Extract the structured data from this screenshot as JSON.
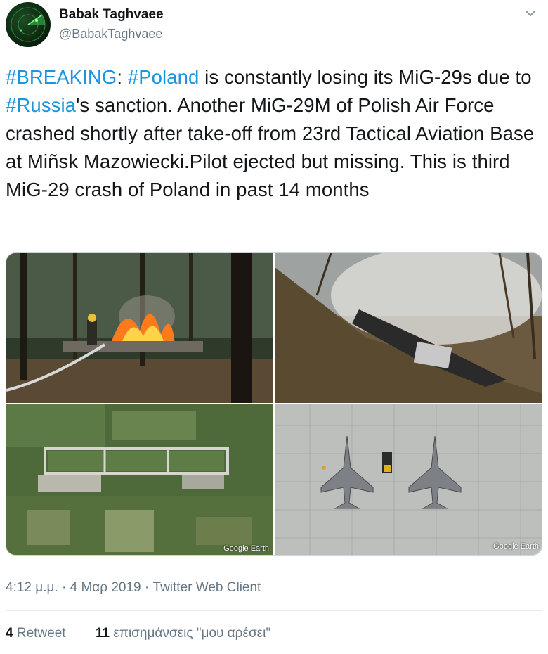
{
  "author": {
    "name": "Babak Taghvaee",
    "handle": "@BabakTaghvaee",
    "avatar_icon": "radar-avatar-icon"
  },
  "menu_icon": "chevron-down-icon",
  "tweet": {
    "segments": [
      {
        "text": "#BREAKING",
        "type": "hashtag"
      },
      {
        "text": ": ",
        "type": "text"
      },
      {
        "text": "#Poland",
        "type": "hashtag"
      },
      {
        "text": " is constantly losing its MiG-29s due to ",
        "type": "text"
      },
      {
        "text": "#Russia",
        "type": "hashtag"
      },
      {
        "text": "'s sanction. Another MiG-29M of Polish Air Force crashed shortly after take-off from 23rd Tactical Aviation Base at Miñsk Mazowiecki.Pilot ejected but missing. This is third MiG-29 crash of Poland in past 14 months",
        "type": "text"
      }
    ]
  },
  "media": {
    "watermark_3": "Google Earth",
    "watermark_4": "Google Earth"
  },
  "meta": {
    "time": "4:12 μ.μ.",
    "sep1": " · ",
    "date": "4 Μαρ 2019",
    "sep2": " · ",
    "client": "Twitter Web Client"
  },
  "stats": {
    "retweets_count": "4",
    "retweets_label": "Retweet",
    "likes_count": "11",
    "likes_label": "επισημάνσεις \"μου αρέσει\""
  },
  "colors": {
    "link": "#1b95e0",
    "secondary_text": "#657786",
    "primary_text": "#14171a"
  }
}
